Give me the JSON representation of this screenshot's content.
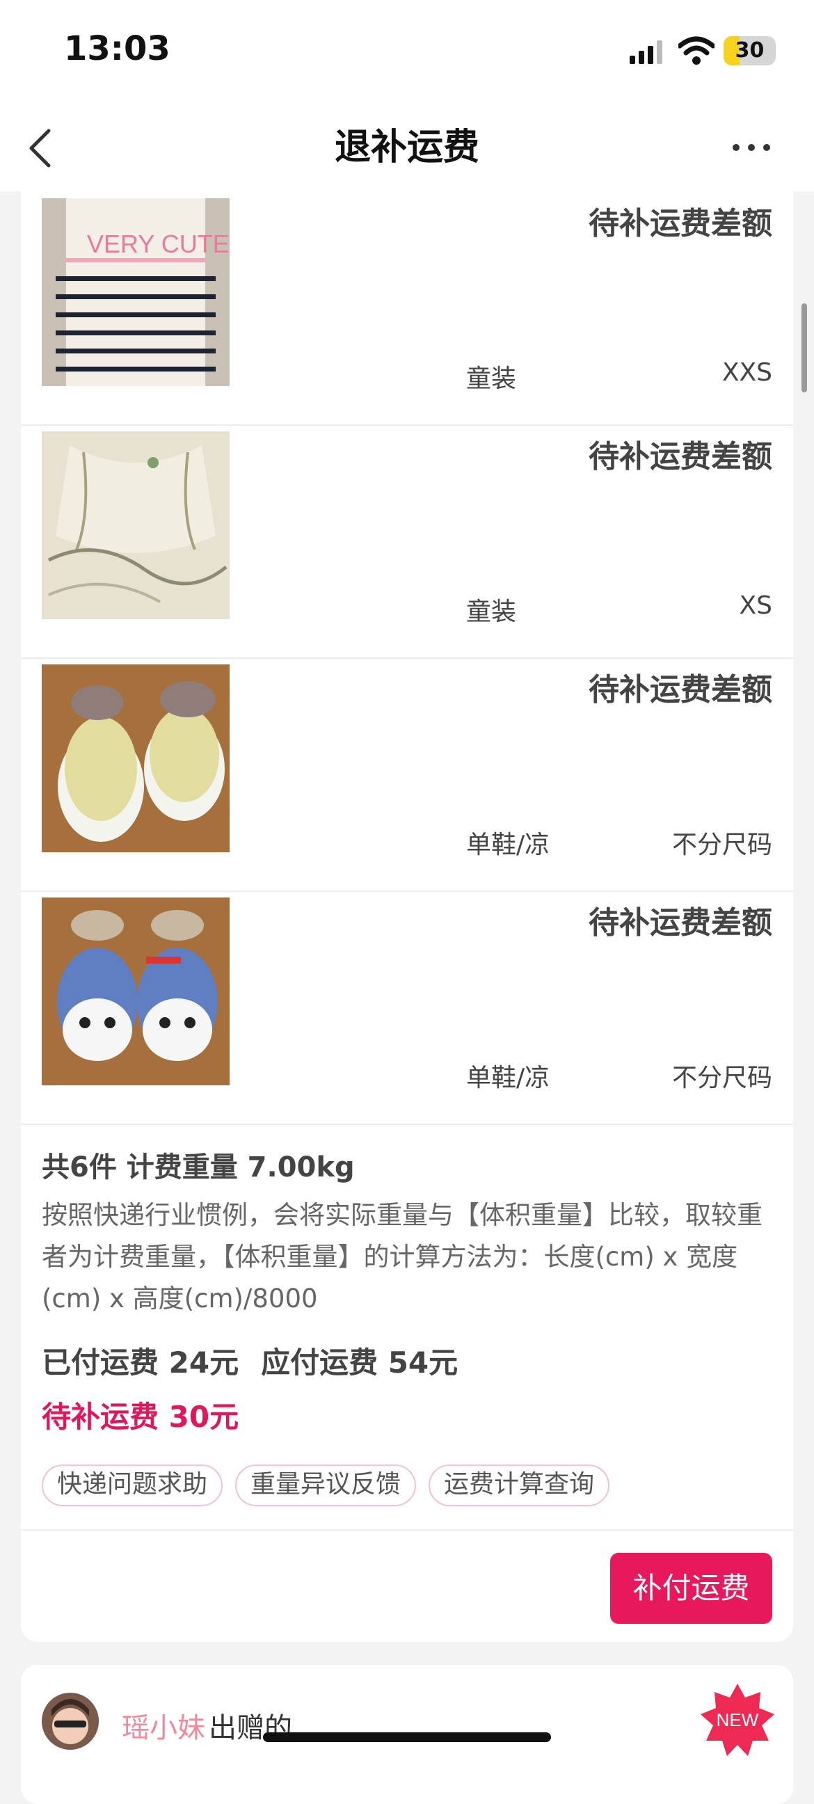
{
  "status_bar": {
    "time": "13:03",
    "battery": "30",
    "battery_level": 0.3
  },
  "nav": {
    "title": "退补运费",
    "back_icon": "chevron-left-icon",
    "more_icon": "ellipsis-icon"
  },
  "items": [
    {
      "label": "待补运费差额",
      "category": "童装",
      "size": "XXS",
      "image": "striped-kids-top-photo"
    },
    {
      "label": "待补运费差额",
      "category": "童装",
      "size": "XS",
      "image": "cream-kids-dress-photo"
    },
    {
      "label": "待补运费差额",
      "category": "单鞋/凉",
      "size": "不分尺码",
      "image": "yellow-baby-shoes-photo"
    },
    {
      "label": "待补运费差额",
      "category": "单鞋/凉",
      "size": "不分尺码",
      "image": "panda-baby-shoes-photo"
    }
  ],
  "summary": {
    "title": "共6件 计费重量 7.00kg",
    "description": "按照快递行业惯例，会将实际重量与【体积重量】比较，取较重者为计费重量，【体积重量】的计算方法为：长度(cm) x 宽度(cm) x 高度(cm)/8000",
    "paid": "已付运费 24元",
    "payable": "应付运费 54元",
    "pending": "待补运费 30元"
  },
  "chips": [
    "快递问题求助",
    "重量异议反馈",
    "运费计算查询"
  ],
  "pay_button": "补付运费",
  "giver": {
    "name": "瑶小妹",
    "suffix": "出赠的",
    "badge": "NEW"
  },
  "colors": {
    "accent": "#e7195a",
    "pending_text": "#e0185a"
  }
}
